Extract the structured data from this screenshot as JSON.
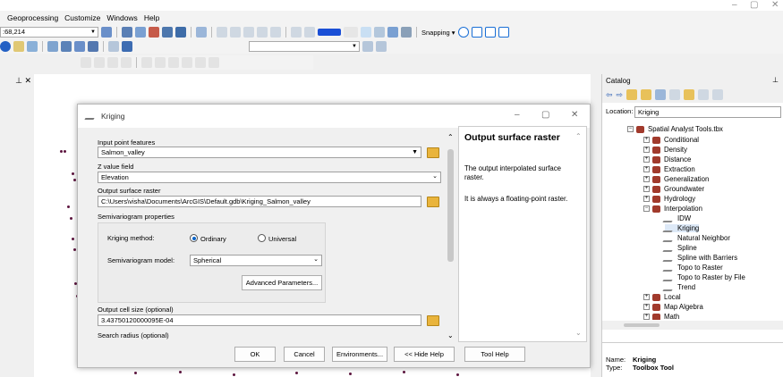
{
  "window": {
    "min": "–",
    "max": "▢",
    "close": "✕"
  },
  "menu": [
    "Geoprocessing",
    "Customize",
    "Windows",
    "Help"
  ],
  "toolbar": {
    "coord": ":68,214",
    "snapping": "Snapping ▾"
  },
  "dialog": {
    "title": "Kriging",
    "input_label": "Input point features",
    "input_value": "Salmon_valley",
    "z_label": "Z value field",
    "z_value": "Elevation",
    "out_label": "Output surface raster",
    "out_value": "C:\\Users\\visha\\Documents\\ArcGIS\\Default.gdb\\Kriging_Salmon_valley",
    "semi_label": "Semivariogram properties",
    "method_label": "Kriging method:",
    "ordinary": "Ordinary",
    "universal": "Universal",
    "model_label": "Semivariogram model:",
    "model_value": "Spherical",
    "advanced": "Advanced Parameters...",
    "cell_label": "Output cell size (optional)",
    "cell_value": "3.43750120000095E-04",
    "search_label": "Search radius (optional)",
    "ok": "OK",
    "cancel": "Cancel",
    "env": "Environments...",
    "hide": "<< Hide Help",
    "help": "Tool Help",
    "help_title": "Output surface raster",
    "help_p1": "The output interpolated surface raster.",
    "help_p2": "It is always a floating-point raster."
  },
  "catalog": {
    "title": "Catalog",
    "location_label": "Location:",
    "location_value": "Kriging",
    "root": "Spatial Analyst Tools.tbx",
    "items": [
      "Conditional",
      "Density",
      "Distance",
      "Extraction",
      "Generalization",
      "Groundwater",
      "Hydrology",
      "Interpolation"
    ],
    "tools": [
      "IDW",
      "Kriging",
      "Natural Neighbor",
      "Spline",
      "Spline with Barriers",
      "Topo to Raster",
      "Topo to Raster by File",
      "Trend"
    ],
    "after": [
      "Local",
      "Map Algebra",
      "Math"
    ],
    "name_label": "Name:",
    "name_value": "Kriging",
    "type_label": "Type:",
    "type_value": "Toolbox Tool"
  }
}
